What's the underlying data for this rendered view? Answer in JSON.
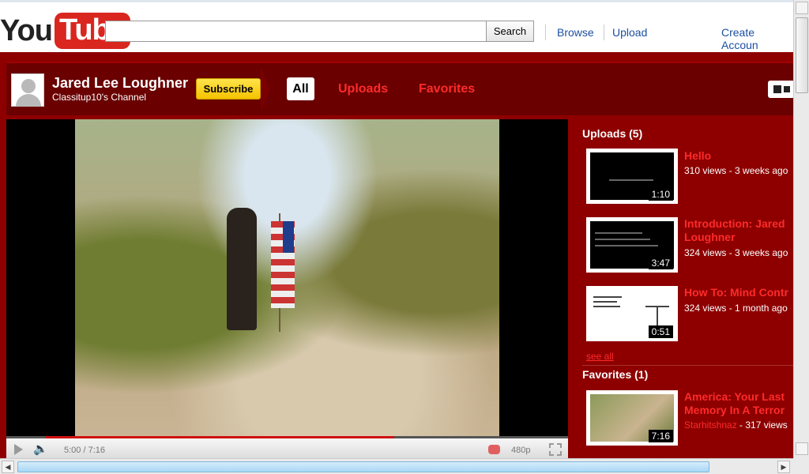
{
  "header": {
    "logo_you": "You",
    "logo_tube": "Tube",
    "search_placeholder": "",
    "search_button": "Search",
    "links": [
      "Browse",
      "Upload",
      "Create Accoun"
    ]
  },
  "channel": {
    "name": "Jared Lee Loughner",
    "subtitle": "Classitup10's Channel",
    "subscribe_label": "Subscribe",
    "tabs": [
      {
        "label": "All",
        "active": true
      },
      {
        "label": "Uploads",
        "active": false
      },
      {
        "label": "Favorites",
        "active": false
      }
    ]
  },
  "player": {
    "time": "5:00 / 7:16",
    "quality": "480p",
    "progress_fraction": 0.69
  },
  "uploads": {
    "heading": "Uploads (5)",
    "items": [
      {
        "title": "Hello",
        "meta": "310 views - 3 weeks ago",
        "duration": "1:10"
      },
      {
        "title": "Introduction: Jared",
        "title2": "Loughner",
        "meta": "324 views - 3 weeks ago",
        "duration": "3:47"
      },
      {
        "title": "How To: Mind Contr",
        "meta": "324 views - 1 month ago",
        "duration": "0:51"
      }
    ],
    "see_all": "see all"
  },
  "favorites": {
    "heading": "Favorites (1)",
    "items": [
      {
        "title": "America: Your Last",
        "title2": "Memory In A Terror",
        "author": "Starhitshnaz",
        "views": " - 317 views",
        "duration": "7:16"
      }
    ]
  },
  "colors": {
    "brand_red": "#d9261f",
    "channel_bg": "#8e0000",
    "link_red": "#ff2a2a",
    "link_blue": "#1c4fa0"
  }
}
